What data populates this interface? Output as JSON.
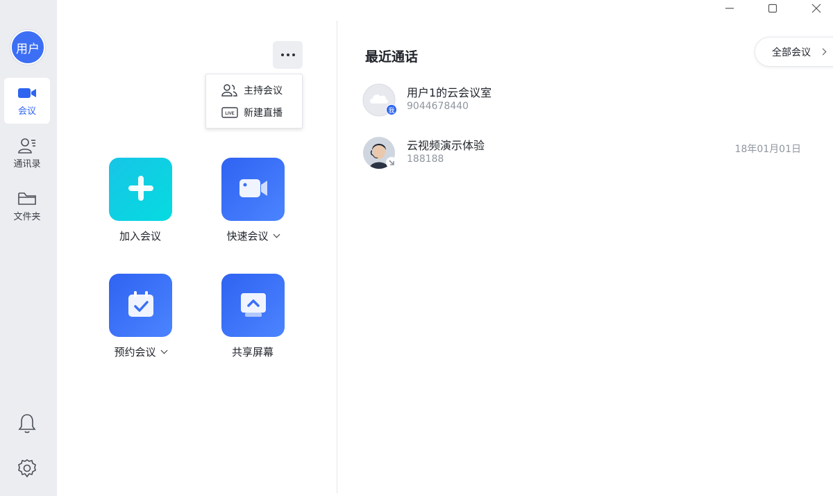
{
  "window": {
    "minimize_icon": "minimize-icon",
    "maximize_icon": "maximize-icon",
    "close_icon": "close-icon"
  },
  "sidebar": {
    "avatar_text": "用户",
    "items": [
      {
        "label": "会议",
        "icon": "video-camera-icon",
        "active": true
      },
      {
        "label": "通讯录",
        "icon": "contacts-icon",
        "active": false
      },
      {
        "label": "文件夹",
        "icon": "folder-icon",
        "active": false
      }
    ],
    "bottom_icons": [
      "bell-icon",
      "gear-icon"
    ]
  },
  "more_menu": {
    "icon": "more-dots-icon",
    "items": [
      {
        "label": "主持会议",
        "icon": "host-users-icon"
      },
      {
        "label": "新建直播",
        "icon": "live-icon",
        "icon_text": "LIVE"
      }
    ]
  },
  "actions": [
    {
      "label": "加入会议",
      "icon": "plus-icon",
      "has_dropdown": false
    },
    {
      "label": "快速会议",
      "icon": "video-camera-icon",
      "has_dropdown": true
    },
    {
      "label": "预约会议",
      "icon": "calendar-check-icon",
      "has_dropdown": true
    },
    {
      "label": "共享屏幕",
      "icon": "screen-share-icon",
      "has_dropdown": false
    }
  ],
  "recent_calls": {
    "title": "最近通话",
    "all_button_label": "全部会议",
    "items": [
      {
        "name": "用户1的云会议室",
        "number": "9044678440",
        "date": "",
        "badge": "我",
        "avatar": "cloud-avatar-icon"
      },
      {
        "name": "云视频演示体验",
        "number": "188188",
        "date": "18年01月01日",
        "badge": "",
        "avatar": "person-avatar"
      }
    ]
  },
  "colors": {
    "accent": "#2d65f0",
    "sidebar_bg": "#ecedf1",
    "tile_cyan": "#0fd0e3",
    "tile_blue": "#3a70f6",
    "muted_text": "#8f959e"
  }
}
